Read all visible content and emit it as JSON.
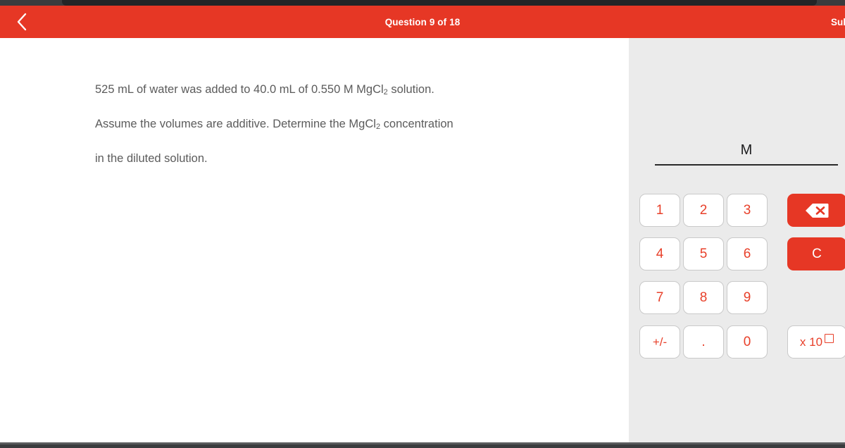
{
  "window": {
    "top_chrome_color": "#3a3c3e",
    "notch_color": "#232527"
  },
  "header": {
    "title": "Question 9 of 18",
    "back_label": "back-chevron",
    "submit_label": "Submit",
    "background_color": "#e63725",
    "text_color": "#ffffff"
  },
  "question": {
    "text": "525 mL of water was added to 40.0 mL of 0.550 M MgCl₂ solution. Assume the volumes are additive. Determine the MgCl₂ concentration in the diluted solution.",
    "line1": "525 mL of water was added to 40.0 mL of 0.550 M MgCl",
    "line1_sub": "2",
    "line1_end": " solution.",
    "line2": "Assume the volumes are additive. Determine the MgCl",
    "line2_sub": "2",
    "line2_end": " concentration",
    "line3": "in the diluted solution.",
    "text_color": "#5b5b5b"
  },
  "answer": {
    "value": "",
    "unit": "M",
    "placeholder": ""
  },
  "keypad": {
    "accent_color": "#e8402a",
    "action_color": "#e63725",
    "key_background": "#ffffff",
    "pane_background": "#ebebeb",
    "keys": [
      {
        "label": "1",
        "name": "key-1"
      },
      {
        "label": "2",
        "name": "key-2"
      },
      {
        "label": "3",
        "name": "key-3"
      },
      {
        "label": "4",
        "name": "key-4"
      },
      {
        "label": "5",
        "name": "key-5"
      },
      {
        "label": "6",
        "name": "key-6"
      },
      {
        "label": "7",
        "name": "key-7"
      },
      {
        "label": "8",
        "name": "key-8"
      },
      {
        "label": "9",
        "name": "key-9"
      },
      {
        "label": "+/-",
        "name": "key-plus-minus"
      },
      {
        "label": ".",
        "name": "key-decimal"
      },
      {
        "label": "0",
        "name": "key-0"
      }
    ],
    "actions": {
      "backspace_label": "backspace-icon",
      "clear_label": "C",
      "exponent_label": "x 10"
    }
  }
}
